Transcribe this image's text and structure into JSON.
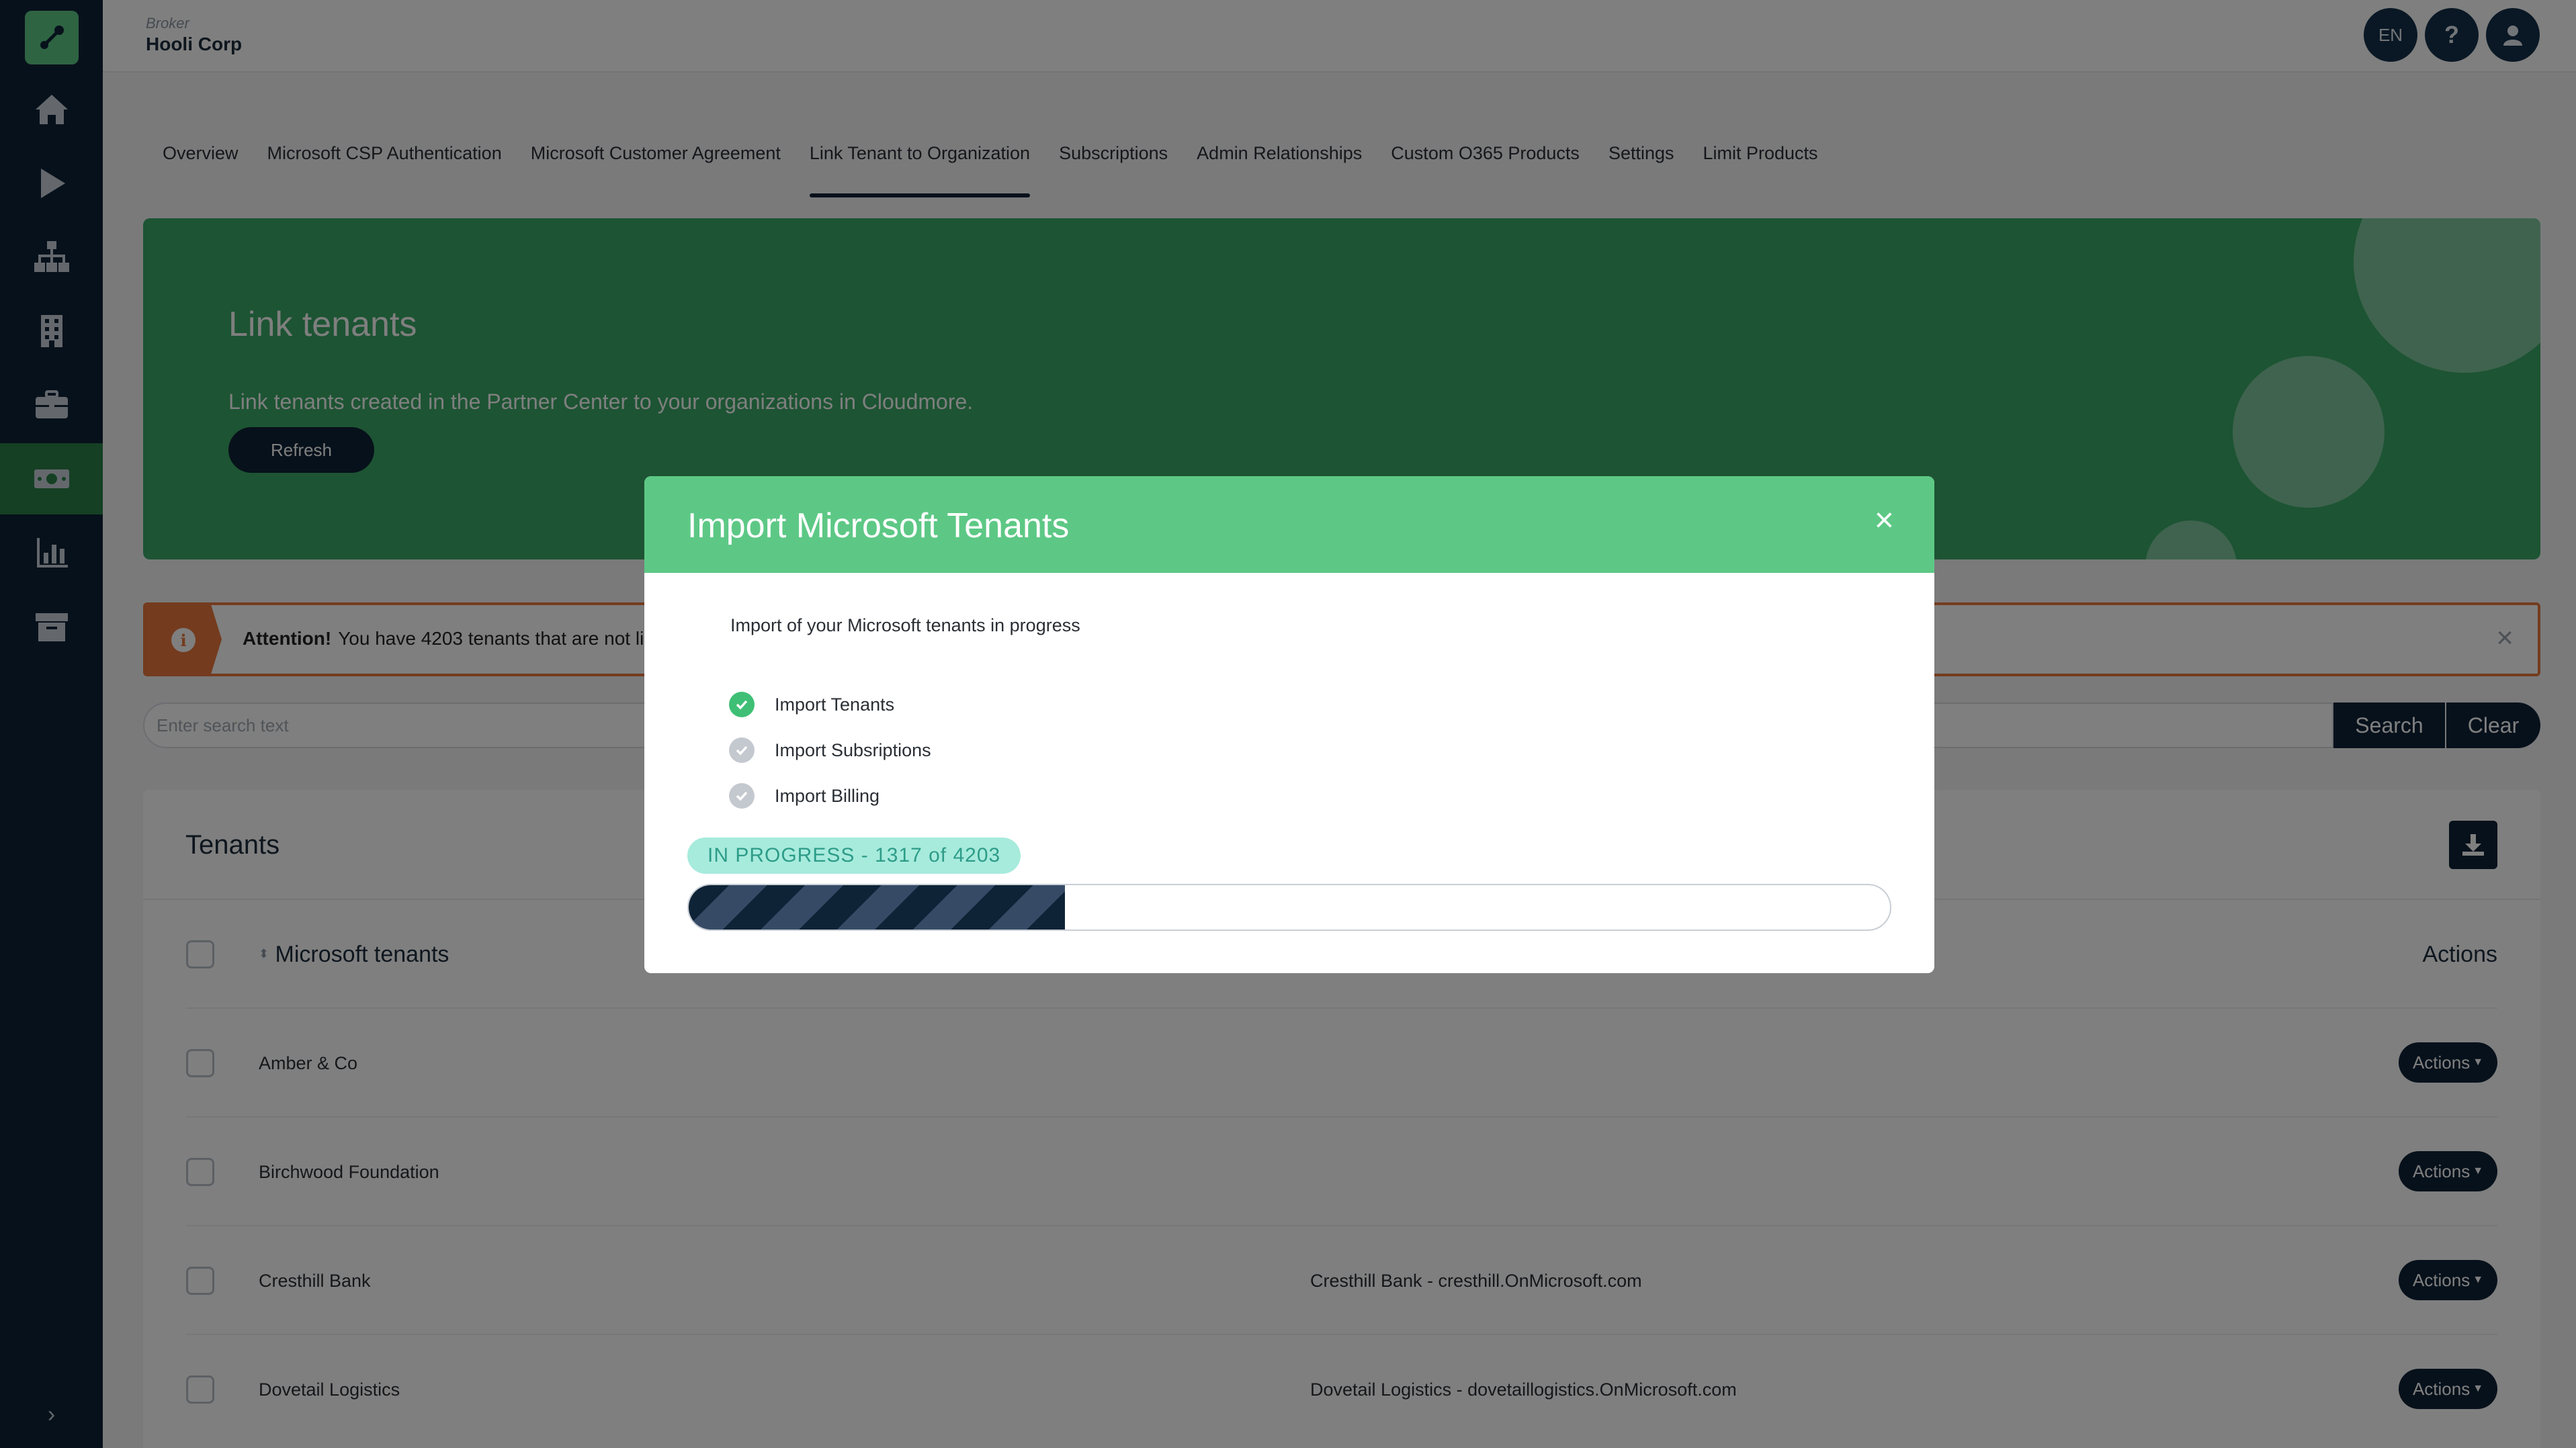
{
  "sidebar": {
    "items": [
      {
        "icon": "home-icon"
      },
      {
        "icon": "play-icon"
      },
      {
        "icon": "sitemap-icon"
      },
      {
        "icon": "building-icon"
      },
      {
        "icon": "briefcase-icon"
      },
      {
        "icon": "money-icon",
        "active": true
      },
      {
        "icon": "bar-chart-icon"
      },
      {
        "icon": "archive-icon"
      }
    ]
  },
  "header": {
    "broker_label": "Broker",
    "broker_name": "Hooli Corp",
    "language": "EN",
    "help": "?"
  },
  "tabs": [
    {
      "label": "Overview"
    },
    {
      "label": "Microsoft CSP Authentication"
    },
    {
      "label": "Microsoft Customer Agreement"
    },
    {
      "label": "Link Tenant to Organization",
      "active": true
    },
    {
      "label": "Subscriptions"
    },
    {
      "label": "Admin Relationships"
    },
    {
      "label": "Custom O365 Products"
    },
    {
      "label": "Settings"
    },
    {
      "label": "Limit Products"
    }
  ],
  "hero": {
    "title": "Link tenants",
    "description": "Link tenants created in the Partner Center to your organizations in Cloudmore.",
    "refresh_label": "Refresh"
  },
  "alert": {
    "strong": "Attention!",
    "text": "You have 4203 tenants that are not li"
  },
  "search": {
    "placeholder": "Enter search text",
    "search_label": "Search",
    "clear_label": "Clear"
  },
  "table": {
    "title": "Tenants",
    "column_tenants": "Microsoft tenants",
    "column_actions": "Actions",
    "action_label": "Actions",
    "rows": [
      {
        "name": "Amber & Co",
        "domain": ""
      },
      {
        "name": "Birchwood Foundation",
        "domain": ""
      },
      {
        "name": "Cresthill Bank",
        "domain": "Cresthill Bank - cresthill.OnMicrosoft.com"
      },
      {
        "name": "Dovetail Logistics",
        "domain": "Dovetail Logistics - dovetaillogistics.OnMicrosoft.com"
      }
    ]
  },
  "modal": {
    "title": "Import Microsoft Tenants",
    "intro": "Import of your Microsoft tenants in progress",
    "steps": [
      {
        "label": "Import Tenants",
        "status": "done"
      },
      {
        "label": "Import Subsriptions",
        "status": "pending"
      },
      {
        "label": "Import Billing",
        "status": "pending"
      }
    ],
    "badge": "IN PROGRESS - 1317 of 4203",
    "progress": {
      "completed": 1317,
      "total": 4203
    }
  },
  "colors": {
    "sidebar": "#0e2336",
    "accent_green": "#5dc885",
    "hero_green": "#3aa867",
    "alert_orange": "#e8763d"
  }
}
